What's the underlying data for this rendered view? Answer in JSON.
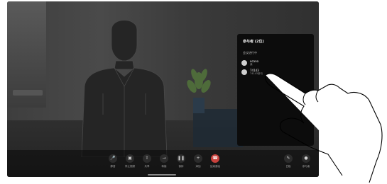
{
  "participants_panel": {
    "title": "参与者 (2位)",
    "section_label": "会议进行中",
    "participants": [
      {
        "name": "ocano",
        "detail": "我"
      },
      {
        "name": "74143",
        "detail": "74143参与"
      }
    ]
  },
  "controls": [
    {
      "label": "静音",
      "icon": "microphone-icon"
    },
    {
      "label": "停止视频",
      "icon": "camera-icon"
    },
    {
      "label": "共享",
      "icon": "share-icon"
    },
    {
      "label": "转接",
      "icon": "transfer-icon"
    },
    {
      "label": "保持",
      "icon": "pause-icon"
    },
    {
      "label": "添加",
      "icon": "add-participant-icon"
    },
    {
      "label": "结束通话",
      "icon": "end-call-icon"
    }
  ],
  "right_controls": [
    {
      "label": "白板",
      "icon": "whiteboard-icon"
    },
    {
      "label": "参与者",
      "icon": "participants-icon"
    }
  ],
  "colors": {
    "end_call": "#c8413c",
    "panel_bg": "#0c0c0c",
    "screen_bg": "#151515"
  }
}
